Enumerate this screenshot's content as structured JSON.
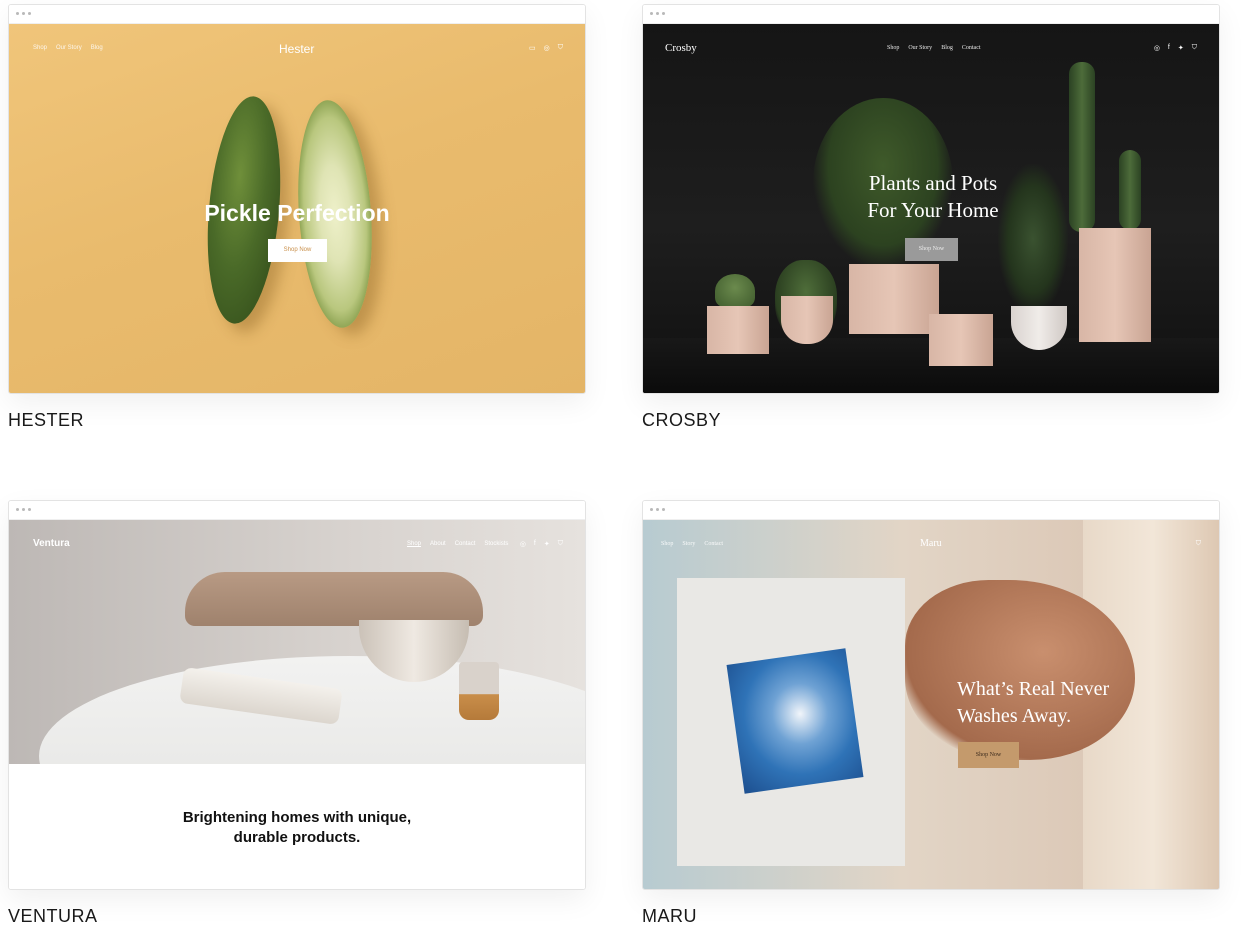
{
  "templates": [
    {
      "id": "hester",
      "caption": "HESTER",
      "site": {
        "nav_links": [
          "Shop",
          "Our Story",
          "Blog"
        ],
        "brand": "Hester",
        "headline": "Pickle Perfection",
        "button": "Shop Now"
      },
      "colors": {
        "background": "#e9bb6d",
        "cucumber": "#4f6e2c",
        "button": "#ffffff"
      }
    },
    {
      "id": "crosby",
      "caption": "CROSBY",
      "site": {
        "nav_links": [
          "Shop",
          "Our Story",
          "Blog",
          "Contact"
        ],
        "brand": "Crosby",
        "headline_line1": "Plants and Pots",
        "headline_line2": "For Your Home",
        "button": "Shop Now"
      },
      "colors": {
        "background": "#1a1a1a",
        "pot": "#dbb9a9",
        "button": "#9a9a9a"
      }
    },
    {
      "id": "ventura",
      "caption": "VENTURA",
      "site": {
        "nav_links": [
          "Shop",
          "About",
          "Contact",
          "Stockists"
        ],
        "brand": "Ventura",
        "tagline_line1": "Brightening homes with unique,",
        "tagline_line2": "durable products."
      },
      "colors": {
        "photo": "#d2cdc9",
        "text": "#111111"
      }
    },
    {
      "id": "maru",
      "caption": "MARU",
      "site": {
        "nav_links": [
          "Shop",
          "Story",
          "Contact"
        ],
        "brand": "Maru",
        "headline_line1": "What’s Real Never",
        "headline_line2": "Washes Away.",
        "button": "Shop Now"
      },
      "colors": {
        "cloth": "#2f73b7",
        "button": "#c49a6c"
      }
    }
  ]
}
